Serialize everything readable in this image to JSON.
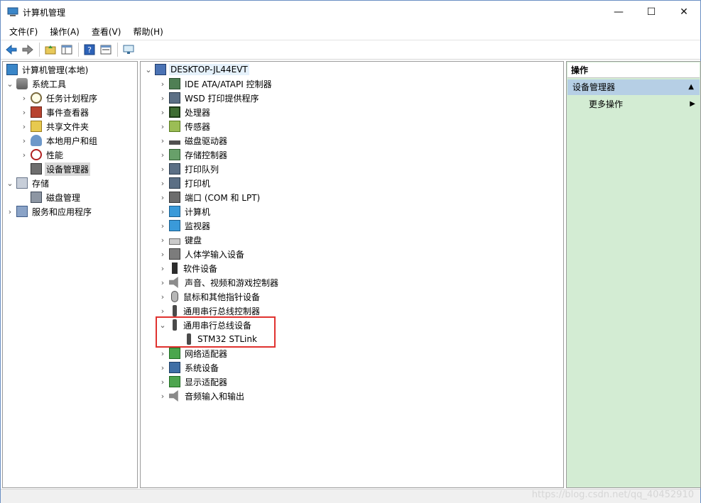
{
  "window": {
    "title": "计算机管理",
    "controls": {
      "minimize": "—",
      "maximize": "☐",
      "close": "✕"
    }
  },
  "menu": [
    "文件(F)",
    "操作(A)",
    "查看(V)",
    "帮助(H)"
  ],
  "toolbar": {
    "icons": [
      "back-arrow-icon",
      "forward-arrow-icon",
      "up-folder-icon",
      "show-hide-tree-icon",
      "help-icon",
      "properties-icon",
      "console-icon"
    ]
  },
  "left_tree": [
    {
      "label": "计算机管理(本地)",
      "arrow": "",
      "icon": "computer-management-icon"
    },
    {
      "label": "系统工具",
      "arrow": "⌄",
      "icon": "tools-icon"
    },
    {
      "label": "任务计划程序",
      "arrow": "›",
      "icon": "clock-icon"
    },
    {
      "label": "事件查看器",
      "arrow": "›",
      "icon": "event-viewer-icon"
    },
    {
      "label": "共享文件夹",
      "arrow": "›",
      "icon": "shared-folder-icon"
    },
    {
      "label": "本地用户和组",
      "arrow": "›",
      "icon": "users-icon"
    },
    {
      "label": "性能",
      "arrow": "›",
      "icon": "performance-icon"
    },
    {
      "label": "设备管理器",
      "arrow": "",
      "icon": "device-manager-icon"
    },
    {
      "label": "存储",
      "arrow": "⌄",
      "icon": "storage-icon"
    },
    {
      "label": "磁盘管理",
      "arrow": "",
      "icon": "disk-management-icon"
    },
    {
      "label": "服务和应用程序",
      "arrow": "›",
      "icon": "services-icon"
    }
  ],
  "device_tree": {
    "root": "DESKTOP-JL44EVT",
    "items": [
      {
        "label": "IDE ATA/ATAPI 控制器",
        "arrow": "›",
        "icon": "ide-controller-icon"
      },
      {
        "label": "WSD 打印提供程序",
        "arrow": "›",
        "icon": "wsd-printer-icon"
      },
      {
        "label": "处理器",
        "arrow": "›",
        "icon": "processor-icon"
      },
      {
        "label": "传感器",
        "arrow": "›",
        "icon": "sensor-icon"
      },
      {
        "label": "磁盘驱动器",
        "arrow": "›",
        "icon": "disk-drive-icon"
      },
      {
        "label": "存储控制器",
        "arrow": "›",
        "icon": "storage-controller-icon"
      },
      {
        "label": "打印队列",
        "arrow": "›",
        "icon": "print-queue-icon"
      },
      {
        "label": "打印机",
        "arrow": "›",
        "icon": "printer-icon"
      },
      {
        "label": "端口 (COM 和 LPT)",
        "arrow": "›",
        "icon": "port-icon"
      },
      {
        "label": "计算机",
        "arrow": "›",
        "icon": "computer-icon"
      },
      {
        "label": "监视器",
        "arrow": "›",
        "icon": "monitor-icon"
      },
      {
        "label": "键盘",
        "arrow": "›",
        "icon": "keyboard-icon"
      },
      {
        "label": "人体学输入设备",
        "arrow": "›",
        "icon": "hid-icon"
      },
      {
        "label": "软件设备",
        "arrow": "›",
        "icon": "software-device-icon"
      },
      {
        "label": "声音、视频和游戏控制器",
        "arrow": "›",
        "icon": "sound-icon"
      },
      {
        "label": "鼠标和其他指针设备",
        "arrow": "›",
        "icon": "mouse-icon"
      },
      {
        "label": "通用串行总线控制器",
        "arrow": "›",
        "icon": "usb-icon"
      },
      {
        "label": "通用串行总线设备",
        "arrow": "⌄",
        "icon": "usb-icon"
      },
      {
        "label": "STM32 STLink",
        "arrow": "",
        "icon": "usb-icon"
      },
      {
        "label": "网络适配器",
        "arrow": "›",
        "icon": "network-adapter-icon"
      },
      {
        "label": "系统设备",
        "arrow": "›",
        "icon": "system-device-icon"
      },
      {
        "label": "显示适配器",
        "arrow": "›",
        "icon": "display-adapter-icon"
      },
      {
        "label": "音频输入和输出",
        "arrow": "›",
        "icon": "audio-icon"
      }
    ]
  },
  "actions": {
    "header": "操作",
    "section": "设备管理器",
    "more": "更多操作"
  },
  "watermark": "https://blog.csdn.net/qq_40452910",
  "colors": {
    "highlight_box": "#e0322f",
    "action_pane_bg": "#d3ecd3",
    "action_section_bg": "#b6cfe5"
  }
}
